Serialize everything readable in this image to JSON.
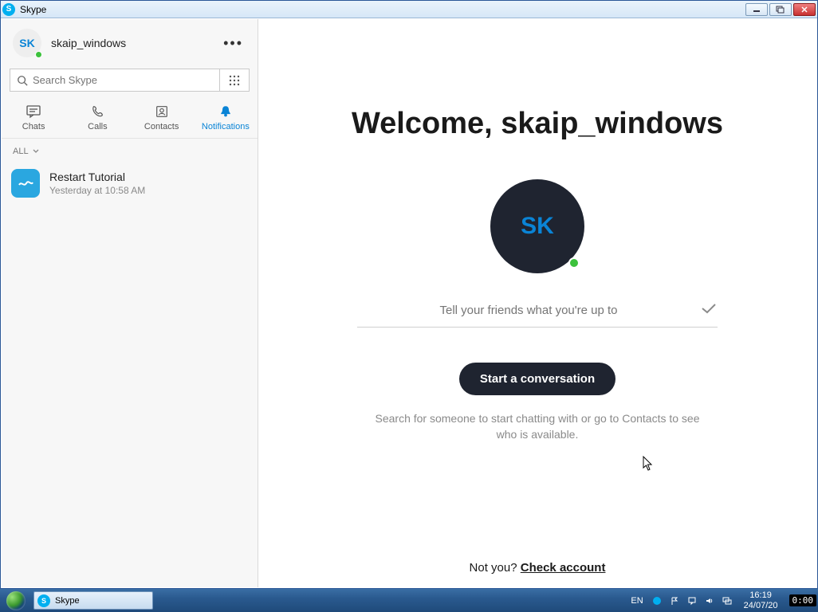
{
  "window": {
    "title": "Skype"
  },
  "profile": {
    "initials": "SK",
    "name": "skaip_windows"
  },
  "search": {
    "placeholder": "Search Skype"
  },
  "tabs": {
    "chats": "Chats",
    "calls": "Calls",
    "contacts": "Contacts",
    "notifications": "Notifications"
  },
  "filter": {
    "label": "ALL"
  },
  "list": {
    "items": [
      {
        "title": "Restart Tutorial",
        "sub": "Yesterday at 10:58 AM"
      }
    ]
  },
  "main": {
    "welcome": "Welcome, skaip_windows",
    "avatar_initials": "SK",
    "status_placeholder": "Tell your friends what you're up to",
    "start_button": "Start a conversation",
    "hint": "Search for someone to start chatting with or go to Contacts to see who is available.",
    "notyou_prefix": "Not you? ",
    "notyou_link": "Check account"
  },
  "taskbar": {
    "app": "Skype",
    "lang": "EN",
    "time": "16:19",
    "date": "24/07/20",
    "timer": "0:00"
  }
}
